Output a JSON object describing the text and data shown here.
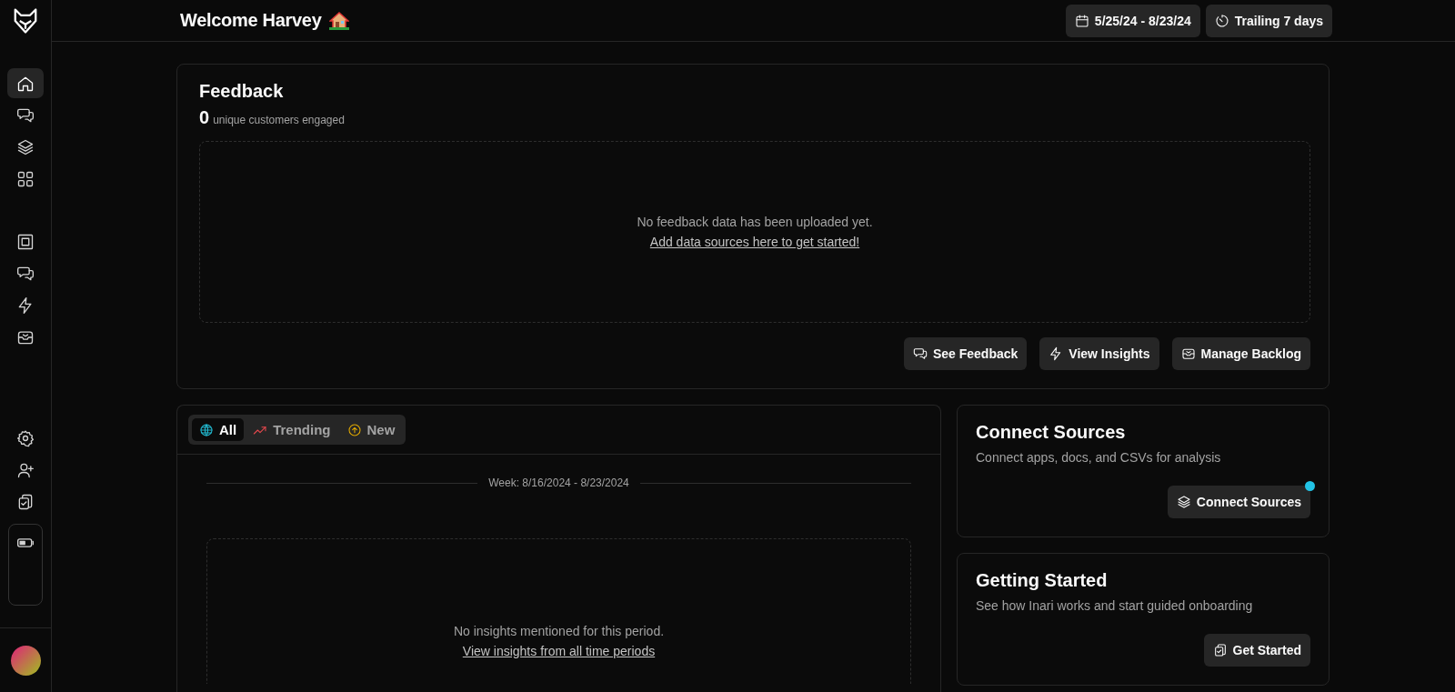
{
  "header": {
    "title": "Welcome Harvey",
    "buttons": [
      {
        "label": "5/25/24 - 8/23/24"
      },
      {
        "label": "Trailing 7 days"
      }
    ]
  },
  "sidebar": {
    "groups": [
      [
        {
          "selected": true
        },
        {
          "selected": false
        },
        {
          "selected": false
        },
        {
          "selected": false
        }
      ],
      [
        {
          "selected": false
        },
        {
          "selected": false
        },
        {
          "selected": false
        },
        {
          "selected": false
        }
      ],
      [
        {
          "selected": false
        },
        {
          "selected": false
        },
        {
          "selected": false
        }
      ]
    ]
  },
  "feedback": {
    "title": "Feedback",
    "count": "0",
    "count_label": "unique customers engaged",
    "empty_text": "No feedback data has been uploaded yet.",
    "empty_link": "Add data sources here to get started!",
    "buttons": [
      {
        "label": "See Feedback"
      },
      {
        "label": "View Insights"
      },
      {
        "label": "Manage Backlog"
      }
    ]
  },
  "insights": {
    "tabs": [
      {
        "label": "All",
        "selected": true
      },
      {
        "label": "Trending",
        "selected": false
      },
      {
        "label": "New",
        "selected": false
      }
    ],
    "week": "Week: 8/16/2024 - 8/23/2024",
    "empty_text": "No insights mentioned for this period.",
    "empty_link": "View insights from all time periods"
  },
  "cards": [
    {
      "title": "Connect Sources",
      "description": "Connect apps, docs, and CSVs for analysis",
      "button": "Connect Sources",
      "notification": true
    },
    {
      "title": "Getting Started",
      "description": "See how Inari works and start guided onboarding",
      "button": "Get Started",
      "notification": false
    }
  ]
}
